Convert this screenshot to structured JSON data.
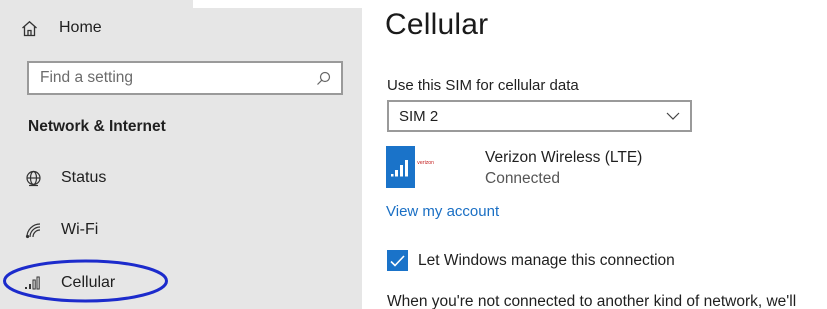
{
  "sidebar": {
    "home_label": "Home",
    "search_placeholder": "Find a setting",
    "section_title": "Network & Internet",
    "items": [
      {
        "label": "Status",
        "icon": "globe-icon"
      },
      {
        "label": "Wi-Fi",
        "icon": "wifi-icon"
      },
      {
        "label": "Cellular",
        "icon": "cellular-signal-icon"
      }
    ],
    "highlighted_item": "Cellular",
    "highlight_color": "#1c2bcc"
  },
  "main": {
    "title": "Cellular",
    "sim_label": "Use this SIM for cellular data",
    "sim_selected": "SIM 2",
    "carrier": {
      "logo_text": "verizon",
      "name": "Verizon Wireless (LTE)",
      "status": "Connected"
    },
    "account_link": "View my account",
    "manage_checkbox": {
      "label": "Let Windows manage this connection",
      "checked": true
    },
    "footer_text": "When you're not connected to another kind of network, we'll"
  },
  "colors": {
    "accent": "#1a73c9",
    "link": "#1a6fc4",
    "sidebar_bg": "#e6e6e6"
  }
}
